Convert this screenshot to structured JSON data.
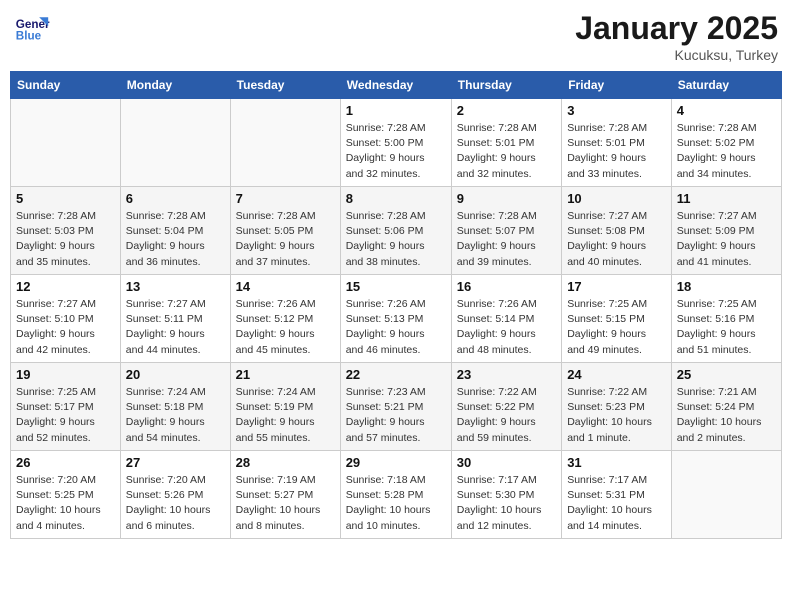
{
  "logo": {
    "line1": "General",
    "line2": "Blue"
  },
  "title": "January 2025",
  "subtitle": "Kucuksu, Turkey",
  "headers": [
    "Sunday",
    "Monday",
    "Tuesday",
    "Wednesday",
    "Thursday",
    "Friday",
    "Saturday"
  ],
  "weeks": [
    [
      {
        "day": "",
        "info": ""
      },
      {
        "day": "",
        "info": ""
      },
      {
        "day": "",
        "info": ""
      },
      {
        "day": "1",
        "info": "Sunrise: 7:28 AM\nSunset: 5:00 PM\nDaylight: 9 hours\nand 32 minutes."
      },
      {
        "day": "2",
        "info": "Sunrise: 7:28 AM\nSunset: 5:01 PM\nDaylight: 9 hours\nand 32 minutes."
      },
      {
        "day": "3",
        "info": "Sunrise: 7:28 AM\nSunset: 5:01 PM\nDaylight: 9 hours\nand 33 minutes."
      },
      {
        "day": "4",
        "info": "Sunrise: 7:28 AM\nSunset: 5:02 PM\nDaylight: 9 hours\nand 34 minutes."
      }
    ],
    [
      {
        "day": "5",
        "info": "Sunrise: 7:28 AM\nSunset: 5:03 PM\nDaylight: 9 hours\nand 35 minutes."
      },
      {
        "day": "6",
        "info": "Sunrise: 7:28 AM\nSunset: 5:04 PM\nDaylight: 9 hours\nand 36 minutes."
      },
      {
        "day": "7",
        "info": "Sunrise: 7:28 AM\nSunset: 5:05 PM\nDaylight: 9 hours\nand 37 minutes."
      },
      {
        "day": "8",
        "info": "Sunrise: 7:28 AM\nSunset: 5:06 PM\nDaylight: 9 hours\nand 38 minutes."
      },
      {
        "day": "9",
        "info": "Sunrise: 7:28 AM\nSunset: 5:07 PM\nDaylight: 9 hours\nand 39 minutes."
      },
      {
        "day": "10",
        "info": "Sunrise: 7:27 AM\nSunset: 5:08 PM\nDaylight: 9 hours\nand 40 minutes."
      },
      {
        "day": "11",
        "info": "Sunrise: 7:27 AM\nSunset: 5:09 PM\nDaylight: 9 hours\nand 41 minutes."
      }
    ],
    [
      {
        "day": "12",
        "info": "Sunrise: 7:27 AM\nSunset: 5:10 PM\nDaylight: 9 hours\nand 42 minutes."
      },
      {
        "day": "13",
        "info": "Sunrise: 7:27 AM\nSunset: 5:11 PM\nDaylight: 9 hours\nand 44 minutes."
      },
      {
        "day": "14",
        "info": "Sunrise: 7:26 AM\nSunset: 5:12 PM\nDaylight: 9 hours\nand 45 minutes."
      },
      {
        "day": "15",
        "info": "Sunrise: 7:26 AM\nSunset: 5:13 PM\nDaylight: 9 hours\nand 46 minutes."
      },
      {
        "day": "16",
        "info": "Sunrise: 7:26 AM\nSunset: 5:14 PM\nDaylight: 9 hours\nand 48 minutes."
      },
      {
        "day": "17",
        "info": "Sunrise: 7:25 AM\nSunset: 5:15 PM\nDaylight: 9 hours\nand 49 minutes."
      },
      {
        "day": "18",
        "info": "Sunrise: 7:25 AM\nSunset: 5:16 PM\nDaylight: 9 hours\nand 51 minutes."
      }
    ],
    [
      {
        "day": "19",
        "info": "Sunrise: 7:25 AM\nSunset: 5:17 PM\nDaylight: 9 hours\nand 52 minutes."
      },
      {
        "day": "20",
        "info": "Sunrise: 7:24 AM\nSunset: 5:18 PM\nDaylight: 9 hours\nand 54 minutes."
      },
      {
        "day": "21",
        "info": "Sunrise: 7:24 AM\nSunset: 5:19 PM\nDaylight: 9 hours\nand 55 minutes."
      },
      {
        "day": "22",
        "info": "Sunrise: 7:23 AM\nSunset: 5:21 PM\nDaylight: 9 hours\nand 57 minutes."
      },
      {
        "day": "23",
        "info": "Sunrise: 7:22 AM\nSunset: 5:22 PM\nDaylight: 9 hours\nand 59 minutes."
      },
      {
        "day": "24",
        "info": "Sunrise: 7:22 AM\nSunset: 5:23 PM\nDaylight: 10 hours\nand 1 minute."
      },
      {
        "day": "25",
        "info": "Sunrise: 7:21 AM\nSunset: 5:24 PM\nDaylight: 10 hours\nand 2 minutes."
      }
    ],
    [
      {
        "day": "26",
        "info": "Sunrise: 7:20 AM\nSunset: 5:25 PM\nDaylight: 10 hours\nand 4 minutes."
      },
      {
        "day": "27",
        "info": "Sunrise: 7:20 AM\nSunset: 5:26 PM\nDaylight: 10 hours\nand 6 minutes."
      },
      {
        "day": "28",
        "info": "Sunrise: 7:19 AM\nSunset: 5:27 PM\nDaylight: 10 hours\nand 8 minutes."
      },
      {
        "day": "29",
        "info": "Sunrise: 7:18 AM\nSunset: 5:28 PM\nDaylight: 10 hours\nand 10 minutes."
      },
      {
        "day": "30",
        "info": "Sunrise: 7:17 AM\nSunset: 5:30 PM\nDaylight: 10 hours\nand 12 minutes."
      },
      {
        "day": "31",
        "info": "Sunrise: 7:17 AM\nSunset: 5:31 PM\nDaylight: 10 hours\nand 14 minutes."
      },
      {
        "day": "",
        "info": ""
      }
    ]
  ]
}
